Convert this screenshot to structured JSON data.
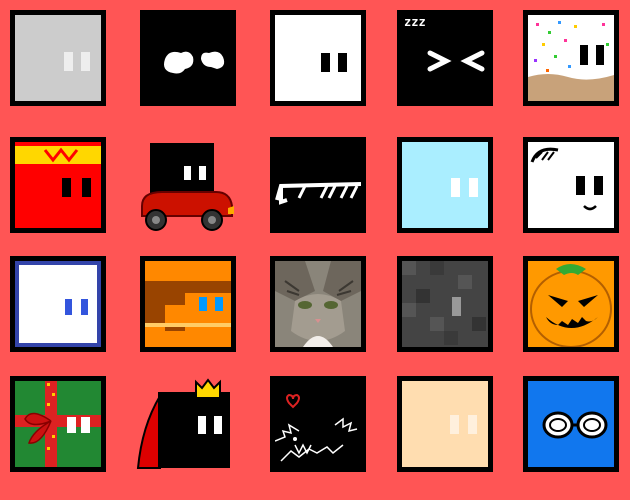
{
  "screen": {
    "title": "",
    "background": "#ff5555",
    "grid": {
      "rows": 4,
      "columns": 5
    }
  },
  "characters": [
    {
      "id": "grey-cube",
      "fill": "#cccccc",
      "eyes": "#eeeeee"
    },
    {
      "id": "cloud-eyes",
      "fill": "#000000",
      "eyes": "#ffffff"
    },
    {
      "id": "white-cube",
      "fill": "#ffffff",
      "eyes": "#000000"
    },
    {
      "id": "sleeping-cube",
      "fill": "#000000",
      "eyes": "#ffffff",
      "overlay_text": "zzz"
    },
    {
      "id": "sprinkle-cube",
      "fill": "#ffffff",
      "eyes": "#000000",
      "accent": "#c8a27a"
    },
    {
      "id": "king-red-cube",
      "fill": "#ff0000",
      "eyes": "#000000",
      "accent": "#ffd700"
    },
    {
      "id": "car-cube",
      "fill": "#000000",
      "eyes": "#ffffff",
      "accent": "#cc1100"
    },
    {
      "id": "sunglasses-cube",
      "fill": "#000000",
      "eyes": "#ffffff"
    },
    {
      "id": "ice-cube",
      "fill": "#aaeeff",
      "eyes": "#ffffff"
    },
    {
      "id": "smiley-cube",
      "fill": "#ffffff",
      "eyes": "#000000"
    },
    {
      "id": "blue-border-cube",
      "fill": "#ffffff",
      "eyes": "#3355dd",
      "accent": "#3344aa"
    },
    {
      "id": "pixel-hair-cube",
      "fill": "#ff8800",
      "eyes": "#0099ff",
      "accent": "#994400"
    },
    {
      "id": "cat-photo-cube",
      "fill": "#888888",
      "eyes": "#556633"
    },
    {
      "id": "dark-pixel-cube",
      "fill": "#444444",
      "eyes": "#999999"
    },
    {
      "id": "pumpkin-cube",
      "fill": "#ff9900",
      "eyes": "#000000",
      "accent": "#33aa33"
    },
    {
      "id": "gift-cube",
      "fill": "#228833",
      "eyes": "#ffffff",
      "accent": "#dd2222"
    },
    {
      "id": "crowned-cube",
      "fill": "#000000",
      "eyes": "#ffffff",
      "accent": "#ffd700"
    },
    {
      "id": "demon-cube",
      "fill": "#000000",
      "eyes": "#ffffff",
      "accent": "#dd2222"
    },
    {
      "id": "peach-cube",
      "fill": "#ffddb0",
      "eyes": "#fff0dd"
    },
    {
      "id": "goggles-cube",
      "fill": "#1177ee",
      "eyes": "#000000"
    }
  ]
}
